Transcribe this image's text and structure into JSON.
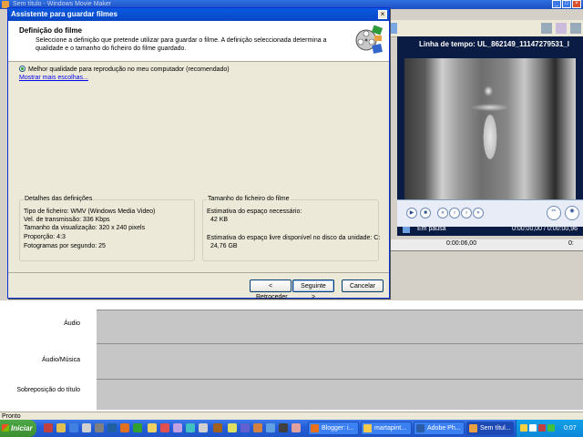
{
  "app": {
    "title": "Sem título - Windows Movie Maker",
    "status": "Pronto"
  },
  "monitor": {
    "title": "Linha de tempo: UL_862149_11147279531_l",
    "state": "Em pausa",
    "time": "0:00:00,00 / 0:00:00,96"
  },
  "timeline": {
    "ruler_mark": "0:00:06,00",
    "tracks": [
      "Áudio",
      "Áudio/Música",
      "Sobreposição do título"
    ]
  },
  "wizard": {
    "title": "Assistente para guardar filmes",
    "heading": "Definição do filme",
    "description": "Seleccione a definição que pretende utilizar para guardar o filme. A definição seleccionada determina a qualidade e o tamanho do ficheiro do filme guardado.",
    "option_label": "Melhor qualidade para reprodução no meu computador (recomendado)",
    "more_choices": "Mostrar mais escolhas...",
    "details": {
      "title": "Detalhes das definições",
      "lines": [
        "Tipo de ficheiro: WMV (Windows Media Video)",
        "Vel. de transmissão: 336 Kbps",
        "Tamanho da visualização: 320 x 240 pixels",
        "Proporção: 4:3",
        "Fotogramas por segundo: 25"
      ]
    },
    "filesize": {
      "title": "Tamanho do ficheiro do filme",
      "space_needed_label": "Estimativa do espaço necessário:",
      "space_needed_value": "42 KB",
      "free_space_label": "Estimativa do espaço livre disponível no disco da unidade: C:",
      "free_space_value": "24,76 GB"
    },
    "buttons": {
      "back": "< Retroceder",
      "next": "Seguinte >",
      "cancel": "Cancelar"
    }
  },
  "taskbar": {
    "start": "Iniciar",
    "tasks": [
      {
        "label": "Blogger: i...",
        "icon": "firefox-icon",
        "color": "#e8701c"
      },
      {
        "label": "martapint...",
        "icon": "folder-icon",
        "color": "#f2c94c"
      },
      {
        "label": "Adobe Ph...",
        "icon": "photoshop-icon",
        "color": "#2a5ca8"
      },
      {
        "label": "Sem títul...",
        "icon": "movie-maker-icon",
        "color": "#e8a040"
      }
    ],
    "clock": "0:07"
  },
  "colors": {
    "xp_blue": "#0a5ae0",
    "dialog_bg": "#ece9d8",
    "link": "#0000ee",
    "monitor_bg": "#0b1c44"
  }
}
